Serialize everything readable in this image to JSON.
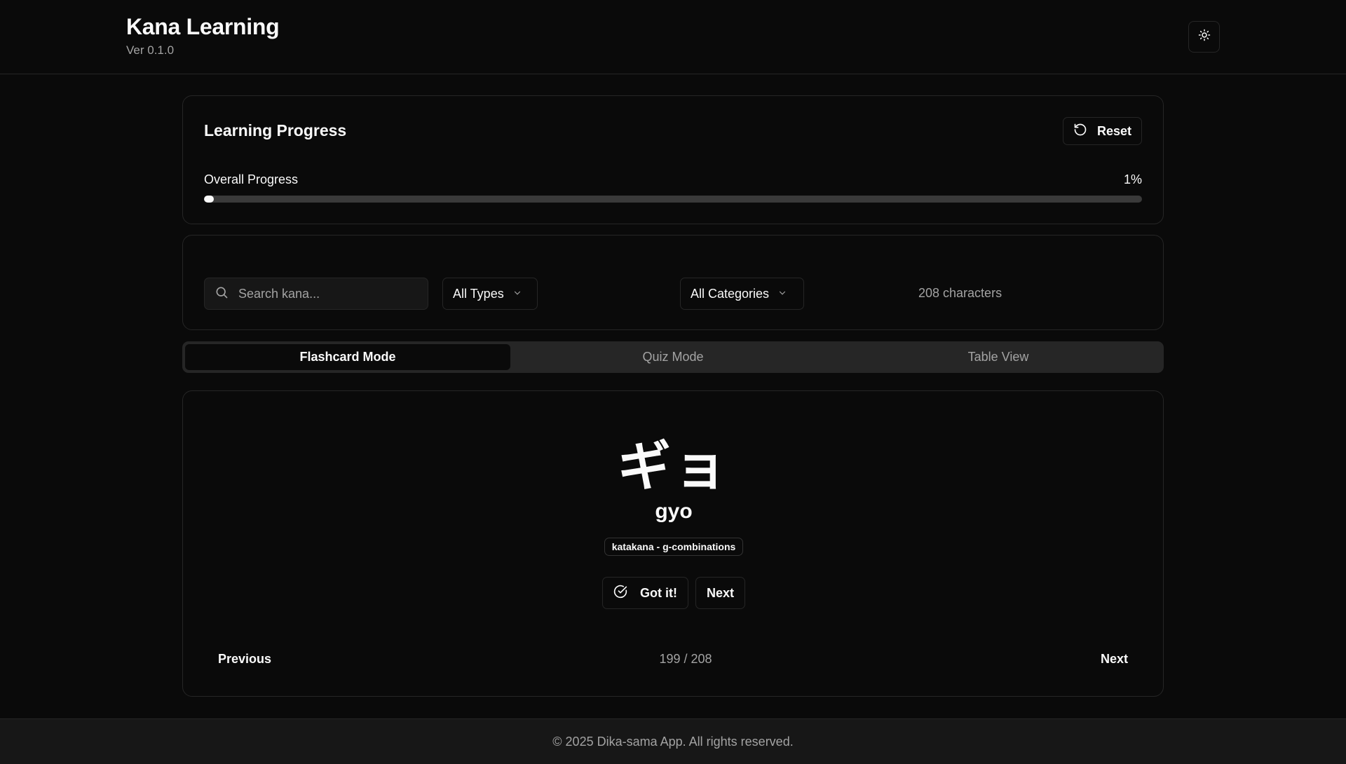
{
  "header": {
    "title": "Kana Learning",
    "version": "Ver 0.1.0",
    "theme_icon": "sun-icon"
  },
  "progress": {
    "title": "Learning Progress",
    "reset_label": "Reset",
    "overall_label": "Overall Progress",
    "overall_value": "1%",
    "overall_fraction": 0.01
  },
  "filters": {
    "search_placeholder": "Search kana...",
    "type_select": "All Types",
    "category_select": "All Categories",
    "count_text": "208 characters"
  },
  "tabs": [
    {
      "label": "Flashcard Mode",
      "active": true
    },
    {
      "label": "Quiz Mode",
      "active": false
    },
    {
      "label": "Table View",
      "active": false
    }
  ],
  "flashcard": {
    "kana": "ギョ",
    "romaji": "gyo",
    "badge": "katakana - g-combinations",
    "got_it_label": "Got it!",
    "next_label": "Next"
  },
  "navigation": {
    "previous_label": "Previous",
    "position": "199 / 208",
    "next_label": "Next"
  },
  "footer": {
    "text": "© 2025 Dika-sama App. All rights reserved."
  },
  "colors": {
    "background": "#0a0a0a",
    "border": "#262626",
    "foreground": "#fafafa",
    "muted": "#a3a3a3"
  }
}
